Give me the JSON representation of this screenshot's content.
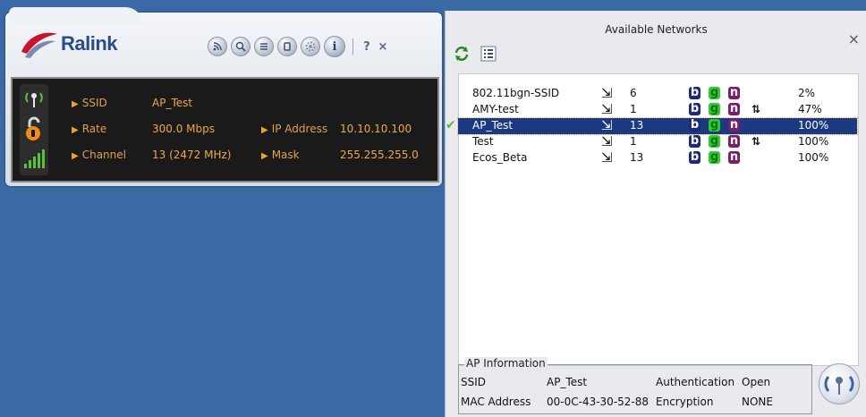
{
  "left_panel": {
    "logo_text": "Ralink",
    "toolbar": {
      "icons": [
        "rss-icon",
        "search-icon",
        "list-icon",
        "page-icon",
        "gear-icon",
        "info-icon"
      ],
      "help_label": "?",
      "close_label": "×"
    },
    "info": {
      "ssid_label": "SSID",
      "ssid_value": "AP_Test",
      "rate_label": "Rate",
      "rate_value": "300.0 Mbps",
      "channel_label": "Channel",
      "channel_value": "13 (2472 MHz)",
      "ip_label": "IP Address",
      "ip_value": "10.10.10.100",
      "mask_label": "Mask",
      "mask_value": "255.255.255.0"
    }
  },
  "right_panel": {
    "title": "Available Networks",
    "close_label": "×",
    "networks": [
      {
        "ssid": "802.11bgn-SSID",
        "channel": "6",
        "b": "b",
        "g": "g",
        "n": "n",
        "wps": false,
        "signal": "2%",
        "connected": false
      },
      {
        "ssid": "AMY-test",
        "channel": "1",
        "b": "b",
        "g": "g",
        "n": "n",
        "wps": true,
        "signal": "47%",
        "connected": false
      },
      {
        "ssid": "AP_Test",
        "channel": "13",
        "b": "b",
        "g": "g",
        "n": "n",
        "wps": false,
        "signal": "100%",
        "connected": true
      },
      {
        "ssid": "Test",
        "channel": "1",
        "b": "b",
        "g": "g",
        "n": "n",
        "wps": true,
        "signal": "100%",
        "connected": false
      },
      {
        "ssid": "Ecos_Beta",
        "channel": "13",
        "b": "b",
        "g": "g",
        "n": "n",
        "wps": false,
        "signal": "100%",
        "connected": false
      }
    ],
    "ap_info": {
      "legend": "AP Information",
      "ssid_label": "SSID",
      "ssid_value": "AP_Test",
      "auth_label": "Authentication",
      "auth_value": "Open",
      "mac_label": "MAC Address",
      "mac_value": "00-0C-43-30-52-88",
      "enc_label": "Encryption",
      "enc_value": "NONE"
    }
  },
  "colors": {
    "desktop": "#3a6aa5",
    "accent_orange": "#f0a84a",
    "selected_row": "#1d3a80",
    "badge_b": "#1d2a7c",
    "badge_g": "#27d02e",
    "badge_n": "#7c1c6c"
  }
}
